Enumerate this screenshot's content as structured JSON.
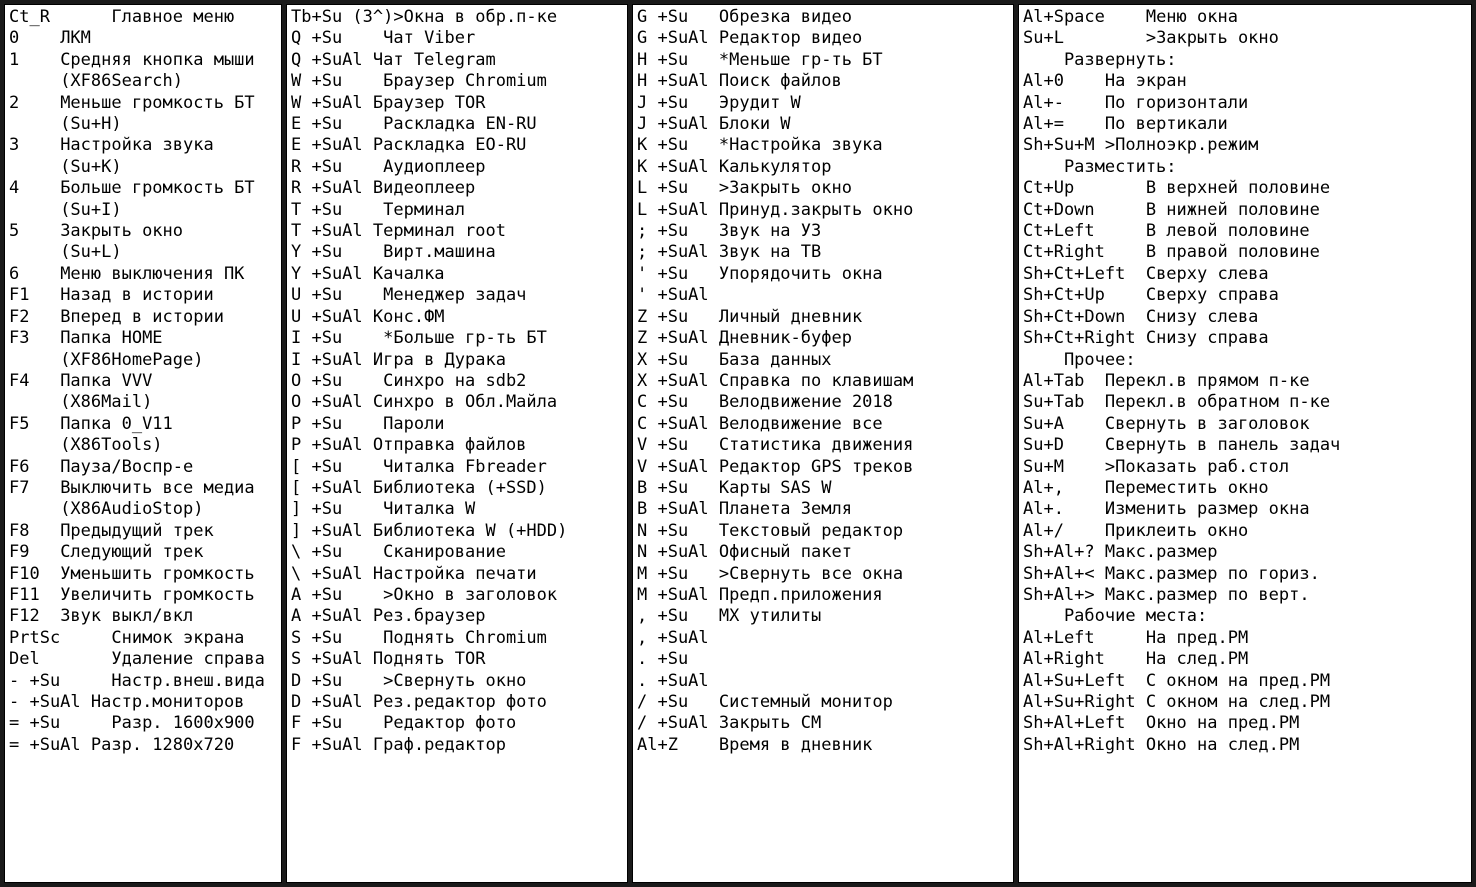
{
  "col1": {
    "kw": 5,
    "rows": [
      [
        "Ct_R",
        "  Главное меню"
      ],
      [
        "0",
        "ЛКМ"
      ],
      [
        "1",
        "Средняя кнопка мыши"
      ],
      [
        "",
        "(XF86Search)"
      ],
      [
        "2",
        "Меньше громкость БТ"
      ],
      [
        "",
        "(Su+H)"
      ],
      [
        "3",
        "Настройка звука"
      ],
      [
        "",
        "(Su+K)"
      ],
      [
        "4",
        "Больше громкость БТ"
      ],
      [
        "",
        "(Su+I)"
      ],
      [
        "5",
        "Закрыть окно"
      ],
      [
        "",
        "(Su+L)"
      ],
      [
        "6",
        "Меню выключения ПК"
      ],
      [
        "F1",
        "Назад в истории"
      ],
      [
        "F2",
        "Вперед в истории"
      ],
      [
        "F3",
        "Папка HOME"
      ],
      [
        "",
        "(XF86HomePage)"
      ],
      [
        "F4",
        "Папка VVV"
      ],
      [
        "",
        "(X86Mail)"
      ],
      [
        "F5",
        "Папка 0_V11"
      ],
      [
        "",
        "(X86Tools)"
      ],
      [
        "F6",
        "Пауза/Воспр-е"
      ],
      [
        "F7",
        "Выключить все медиа"
      ],
      [
        "",
        "(X86AudioStop)"
      ],
      [
        "F8",
        "Предыдущий трек"
      ],
      [
        "F9",
        "Следующий трек"
      ],
      [
        "F10",
        "Уменьшить громкость"
      ],
      [
        "F11",
        "Увеличить громкость"
      ],
      [
        "F12",
        "Звук выкл/вкл"
      ],
      [
        "PrtSc",
        "  Снимок экрана"
      ],
      [
        "Del",
        "  Удаление справа"
      ],
      [
        "- +Su",
        "  Настр.внеш.вида"
      ],
      [
        "- +SuAl",
        "Настр.мониторов"
      ],
      [
        "= +Su",
        "  Разр. 1600x900"
      ],
      [
        "= +SuAl",
        "Разр. 1280x720"
      ]
    ]
  },
  "col2": {
    "kw": 8,
    "rows": [
      [
        "Tb+Su (3^)",
        ">Окна в обр.п-ке"
      ],
      [
        "Q +Su",
        " Чат Viber"
      ],
      [
        "Q +SuAl",
        "Чат Telegram"
      ],
      [
        "W +Su",
        " Браузер Chromium"
      ],
      [
        "W +SuAl",
        "Браузер TOR"
      ],
      [
        "E +Su",
        " Раскладка EN-RU"
      ],
      [
        "E +SuAl",
        "Раскладка EO-RU"
      ],
      [
        "R +Su",
        " Аудиоплеер"
      ],
      [
        "R +SuAl",
        "Видеоплеер"
      ],
      [
        "T +Su",
        " Терминал"
      ],
      [
        "T +SuAl",
        "Терминал root"
      ],
      [
        "Y +Su",
        " Вирт.машина"
      ],
      [
        "Y +SuAl",
        "Качалка"
      ],
      [
        "U +Su",
        " Менеджер задач"
      ],
      [
        "U +SuAl",
        "Конс.ФМ"
      ],
      [
        "I +Su",
        " *Больше гр-ть БТ"
      ],
      [
        "I +SuAl",
        "Игра в Дурака"
      ],
      [
        "O +Su",
        " Синхро на sdb2"
      ],
      [
        "O +SuAl",
        "Синхро в Обл.Майла"
      ],
      [
        "P +Su",
        " Пароли"
      ],
      [
        "P +SuAl",
        "Отправка файлов"
      ],
      [
        "[ +Su",
        " Читалка Fbreader"
      ],
      [
        "[ +SuAl",
        "Библиотека (+SSD)"
      ],
      [
        "] +Su",
        " Читалка W"
      ],
      [
        "] +SuAl",
        "Библиотека W (+HDD)"
      ],
      [
        "\\ +Su",
        " Сканирование"
      ],
      [
        "\\ +SuAl",
        "Настройка печати"
      ],
      [
        "A +Su",
        " >Окно в заголовок"
      ],
      [
        "A +SuAl",
        "Рез.браузер"
      ],
      [
        "S +Su",
        " Поднять Chromium"
      ],
      [
        "S +SuAl",
        "Поднять TOR"
      ],
      [
        "D +Su",
        " >Свернуть окно"
      ],
      [
        "D +SuAl",
        "Рез.редактор фото"
      ],
      [
        "F +Su",
        " Редактор фото"
      ],
      [
        "F +SuAl",
        "Граф.редактор"
      ]
    ]
  },
  "col3": {
    "kw": 8,
    "rows": [
      [
        "G +Su",
        "Обрезка видео"
      ],
      [
        "G +SuAl",
        "Редактор видео"
      ],
      [
        "H +Su",
        "*Меньше гр-ть БТ"
      ],
      [
        "H +SuAl",
        "Поиск файлов"
      ],
      [
        "J +Su",
        "Эрудит W"
      ],
      [
        "J +SuAl",
        "Блоки W"
      ],
      [
        "K +Su",
        "*Настройка звука"
      ],
      [
        "K +SuAl",
        "Калькулятор"
      ],
      [
        "L +Su",
        ">Закрыть окно"
      ],
      [
        "L +SuAl",
        "Принуд.закрыть окно"
      ],
      [
        "; +Su",
        "Звук на УЗ"
      ],
      [
        "; +SuAl",
        "Звук на ТВ"
      ],
      [
        "' +Su",
        "Упорядочить окна"
      ],
      [
        "' +SuAl",
        ""
      ],
      [
        "Z +Su",
        "Личный дневник"
      ],
      [
        "Z +SuAl",
        "Дневник-буфер"
      ],
      [
        "X +Su",
        "База данных"
      ],
      [
        "X +SuAl",
        "Справка по клавишам"
      ],
      [
        "C +Su",
        "Велодвижение 2018"
      ],
      [
        "C +SuAl",
        "Велодвижение все"
      ],
      [
        "V +Su",
        "Статистика движения"
      ],
      [
        "V +SuAl",
        "Редактор GPS треков"
      ],
      [
        "B +Su",
        "Карты SAS W"
      ],
      [
        "B +SuAl",
        "Планета Земля"
      ],
      [
        "N +Su",
        "Текстовый редактор"
      ],
      [
        "N +SuAl",
        "Офисный пакет"
      ],
      [
        "M +Su",
        ">Свернуть все окна"
      ],
      [
        "M +SuAl",
        "Предп.приложения"
      ],
      [
        ", +Su",
        "MX утилиты"
      ],
      [
        ", +SuAl",
        ""
      ],
      [
        ". +Su",
        ""
      ],
      [
        ". +SuAl",
        ""
      ],
      [
        "/ +Su",
        "Системный монитор"
      ],
      [
        "/ +SuAl",
        "Закрыть СМ"
      ],
      [
        "Al+Z",
        "Время в дневник"
      ]
    ]
  },
  "col4": {
    "kw": 12,
    "rows": [
      [
        "Al+Space",
        "Меню окна"
      ],
      [
        "Su+L",
        ">Закрыть окно"
      ],
      [
        "    Развернуть:",
        ""
      ],
      [
        "Al+0",
        "  На экран"
      ],
      [
        "Al+-",
        "  По горизонтали"
      ],
      [
        "Al+=",
        "  По вертикали"
      ],
      [
        "Sh+Su+M",
        "  >Полноэкр.режим"
      ],
      [
        "    Разместить:",
        ""
      ],
      [
        "Ct+Up",
        "В верхней половине"
      ],
      [
        "Ct+Down",
        "В нижней половине"
      ],
      [
        "Ct+Left",
        "В левой половине"
      ],
      [
        "Ct+Right",
        "В правой половине"
      ],
      [
        "Sh+Ct+Left",
        "Сверху слева"
      ],
      [
        "Sh+Ct+Up",
        "Сверху справа"
      ],
      [
        "Sh+Ct+Down",
        "Снизу слева"
      ],
      [
        "Sh+Ct+Right",
        "Снизу справа"
      ],
      [
        "    Прочее:",
        ""
      ],
      [
        "Al+Tab",
        "  Перекл.в прямом п-ке"
      ],
      [
        "Su+Tab",
        "  Перекл.в обратном п-ке"
      ],
      [
        "Su+A",
        "  Свернуть в заголовок"
      ],
      [
        "Su+D",
        "  Свернуть в панель задач"
      ],
      [
        "Su+M",
        "  >Показать раб.стол"
      ],
      [
        "Al+,",
        "  Переместить окно"
      ],
      [
        "Al+.",
        "  Изменить размер окна"
      ],
      [
        "Al+/",
        "  Приклеить окно"
      ],
      [
        "Sh+Al+?",
        "  Макс.размер"
      ],
      [
        "Sh+Al+<",
        "  Макс.размер по гориз."
      ],
      [
        "Sh+Al+>",
        "  Макс.размер по верт."
      ],
      [
        "    Рабочие места:",
        ""
      ],
      [
        "Al+Left",
        "На пред.РМ"
      ],
      [
        "Al+Right",
        "На след.РМ"
      ],
      [
        "Al+Su+Left",
        "С окном на пред.РМ"
      ],
      [
        "Al+Su+Right",
        "С окном на след.РМ"
      ],
      [
        "Sh+Al+Left",
        "Окно на пред.РМ"
      ],
      [
        "Sh+Al+Right",
        "Окно на след.РМ"
      ]
    ]
  }
}
